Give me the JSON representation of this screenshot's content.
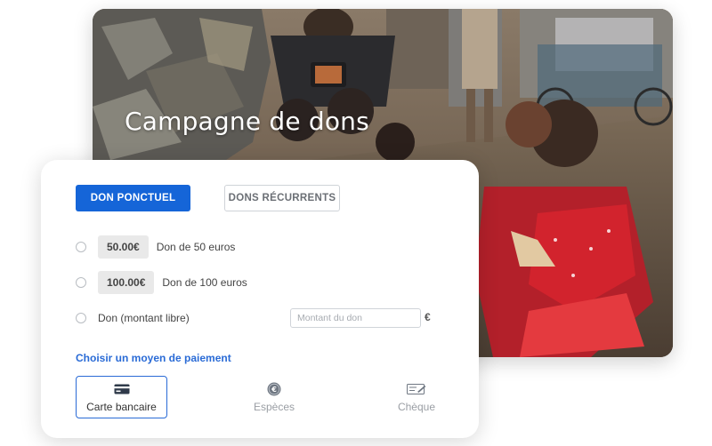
{
  "hero": {
    "title": "Campagne de dons"
  },
  "tabs": [
    {
      "label": "DON PONCTUEL",
      "active": true
    },
    {
      "label": "DONS RÉCURRENTS",
      "active": false
    }
  ],
  "amounts": [
    {
      "value": "50.00€",
      "label": "Don de 50 euros"
    },
    {
      "value": "100.00€",
      "label": "Don de 100 euros"
    }
  ],
  "free_amount": {
    "label": "Don (montant libre)",
    "placeholder": "Montant du don",
    "currency": "€"
  },
  "payment": {
    "title": "Choisir un moyen de paiement",
    "options": [
      {
        "label": "Carte bancaire",
        "icon": "credit-card-icon",
        "selected": true
      },
      {
        "label": "Espèces",
        "icon": "euro-coin-icon",
        "selected": false
      },
      {
        "label": "Chèque",
        "icon": "cheque-icon",
        "selected": false
      }
    ]
  },
  "colors": {
    "accent": "#1565d8",
    "link": "#2a6bd6"
  }
}
